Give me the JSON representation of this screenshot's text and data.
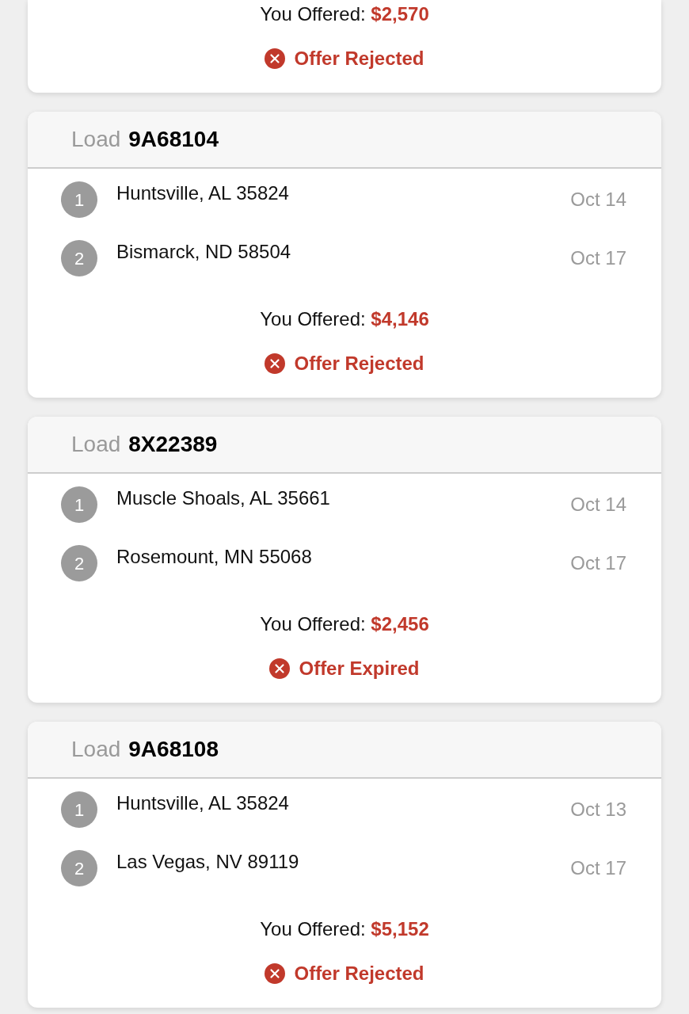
{
  "cards": [
    {
      "offer": {
        "label": "You Offered:",
        "amount": "$2,570"
      },
      "status": "Offer Rejected"
    },
    {
      "header": {
        "label": "Load",
        "id": "9A68104"
      },
      "stops": [
        {
          "number": "1",
          "place": "Huntsville, AL 35824",
          "date": "Oct 14"
        },
        {
          "number": "2",
          "place": "Bismarck, ND 58504",
          "date": "Oct 17"
        }
      ],
      "offer": {
        "label": "You Offered:",
        "amount": "$4,146"
      },
      "status": "Offer Rejected"
    },
    {
      "header": {
        "label": "Load",
        "id": "8X22389"
      },
      "stops": [
        {
          "number": "1",
          "place": "Muscle Shoals, AL 35661",
          "date": "Oct 14"
        },
        {
          "number": "2",
          "place": "Rosemount, MN 55068",
          "date": "Oct 17"
        }
      ],
      "offer": {
        "label": "You Offered:",
        "amount": "$2,456"
      },
      "status": "Offer Expired"
    },
    {
      "header": {
        "label": "Load",
        "id": "9A68108"
      },
      "stops": [
        {
          "number": "1",
          "place": "Huntsville, AL 35824",
          "date": "Oct 13"
        },
        {
          "number": "2",
          "place": "Las Vegas, NV 89119",
          "date": "Oct 17"
        }
      ],
      "offer": {
        "label": "You Offered:",
        "amount": "$5,152"
      },
      "status": "Offer Rejected"
    }
  ]
}
